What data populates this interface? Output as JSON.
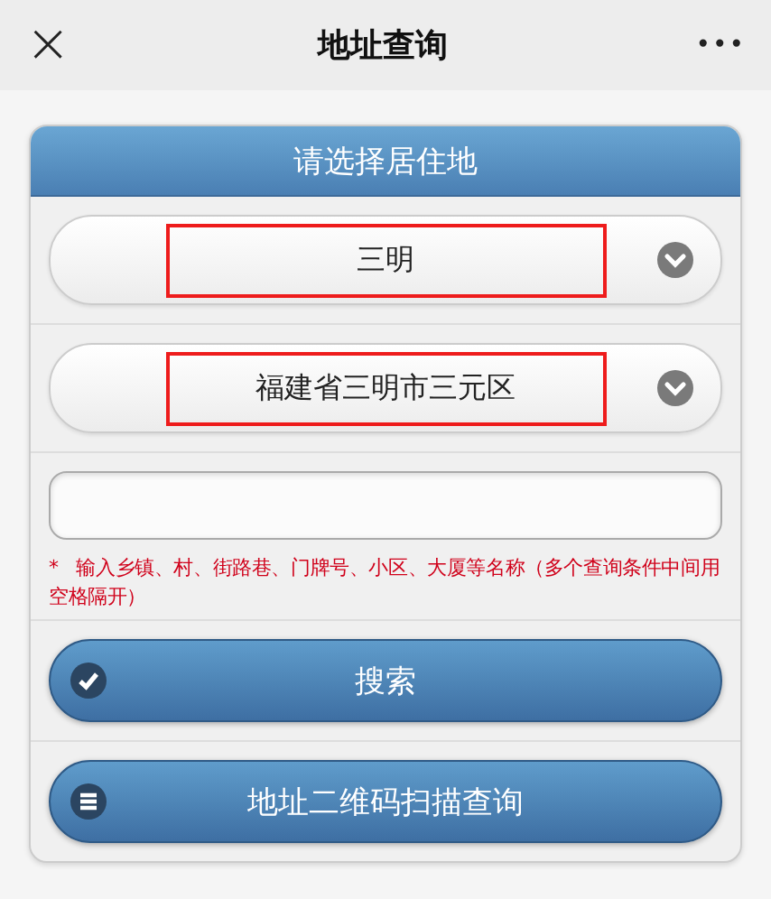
{
  "nav": {
    "close": "×",
    "title": "地址查询",
    "more": "•••"
  },
  "card": {
    "title": "请选择居住地",
    "selects": [
      {
        "value": "三明",
        "highlighted": true
      },
      {
        "value": "福建省三明市三元区",
        "highlighted": true
      }
    ],
    "hint": {
      "mark": "*",
      "text": "输入乡镇、村、街路巷、门牌号、小区、大厦等名称（多个查询条件中间用空格隔开）"
    },
    "buttons": [
      {
        "label": "搜索",
        "kind": "check"
      },
      {
        "label": "地址二维码扫描查询",
        "kind": "menu"
      }
    ]
  }
}
